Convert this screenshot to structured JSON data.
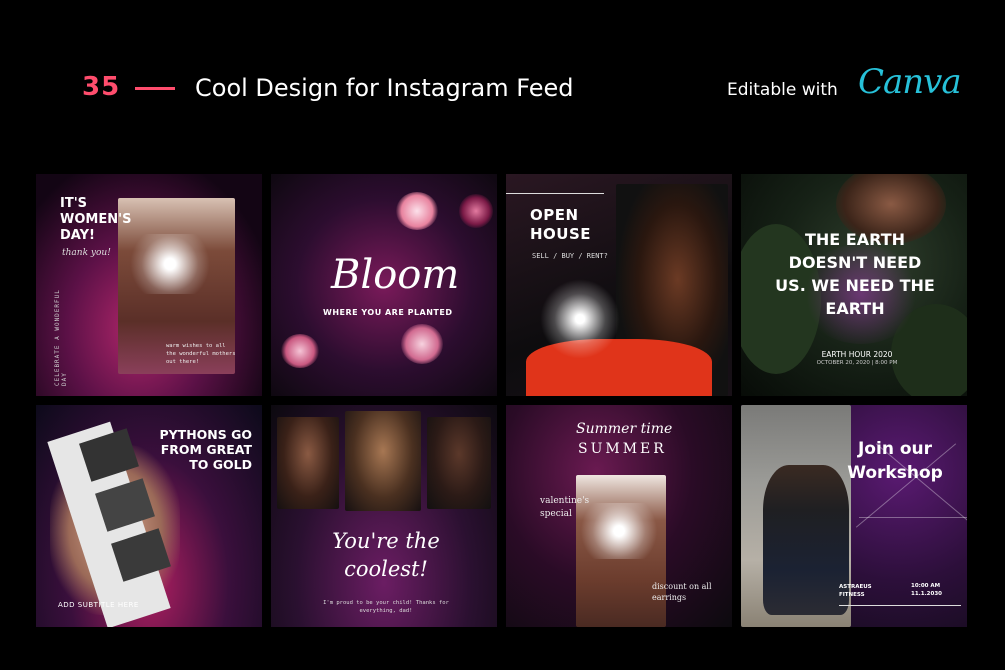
{
  "header": {
    "count": "35",
    "title": "Cool Design for Instagram Feed",
    "editable": "Editable with",
    "brand": "Canva"
  },
  "colors": {
    "accent": "#ff4d6d",
    "brand": "#27c1d9",
    "background": "#000000"
  },
  "tiles": [
    {
      "heading": "IT'S WOMEN'S DAY!",
      "script": "thank you!",
      "side": "CELEBRATE A WONDERFUL DAY",
      "note": "warm wishes to all the wonderful mothers out there!"
    },
    {
      "heading": "Bloom",
      "sub": "WHERE YOU ARE PLANTED"
    },
    {
      "heading": "OPEN HOUSE",
      "sub": "SELL / BUY / RENT?"
    },
    {
      "heading": "THE EARTH DOESN'T NEED US. WE NEED THE EARTH",
      "event": "EARTH HOUR 2020",
      "date": "OCTOBER 20, 2020 | 8:00 PM"
    },
    {
      "heading": "PYTHONS GO FROM GREAT TO GOLD",
      "sub": "ADD SUBTITLE HERE"
    },
    {
      "heading": "You're the coolest!",
      "note": "I'm proud to be your child! Thanks for everything, dad!"
    },
    {
      "script": "Summer time",
      "heading": "SUMMER",
      "left": "valentine's special",
      "right": "discount on all earrings"
    },
    {
      "heading": "Join our Workshop",
      "name": "ASTRAEUS FITNESS",
      "time": "10:00 AM",
      "date": "11.1.2030"
    }
  ]
}
